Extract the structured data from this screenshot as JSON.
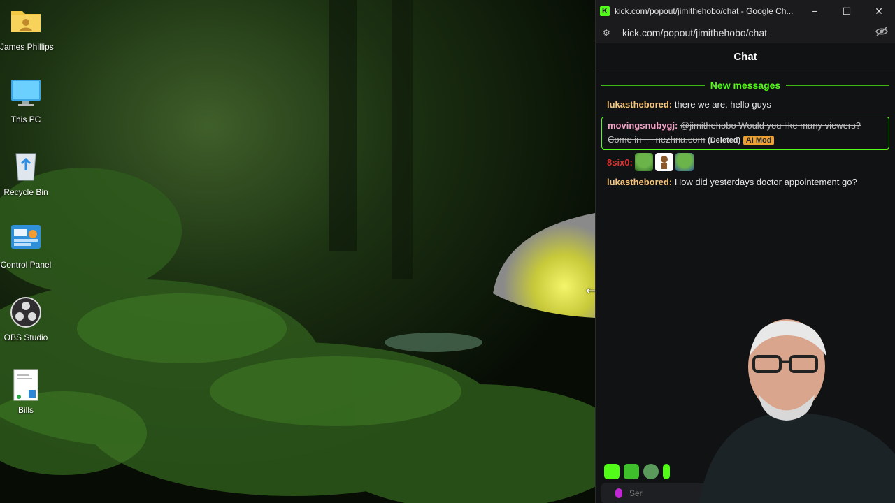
{
  "desktop": {
    "icons": [
      {
        "label": "James Phillips",
        "icon": "user-folder-icon"
      },
      {
        "label": "This PC",
        "icon": "monitor-icon"
      },
      {
        "label": "Recycle Bin",
        "icon": "recycle-bin-icon"
      },
      {
        "label": "Control Panel",
        "icon": "control-panel-icon"
      },
      {
        "label": "OBS Studio",
        "icon": "obs-icon"
      },
      {
        "label": "Bills",
        "icon": "document-icon"
      }
    ]
  },
  "window": {
    "title": "kick.com/popout/jimithehobo/chat - Google Ch...",
    "url": "kick.com/popout/jimithehobo/chat",
    "logo_letter": "K",
    "minimize": "−",
    "maximize": "☐",
    "close": "✕"
  },
  "chat": {
    "header": "Chat",
    "new_messages_label": "New messages",
    "messages": [
      {
        "user": "lukasthebored:",
        "user_color": "#f5c57a",
        "text": "there we are. hello guys"
      },
      {
        "user": "movingsnubygj:",
        "user_color": "#f5a3c7",
        "text": "@jimithehobo Would you like many viewers? Come in — nezhna.com",
        "deleted_tag": "(Deleted)",
        "mod_tag": "AI Mod"
      },
      {
        "user": "8six0:",
        "user_color": "#e0302e"
      },
      {
        "user": "lukasthebored:",
        "user_color": "#f5c57a",
        "text": "How did yesterdays doctor appointement go?"
      }
    ],
    "input_placeholder": "Ser"
  },
  "colors": {
    "accent": "#53fc18",
    "window_bg": "#111214"
  }
}
